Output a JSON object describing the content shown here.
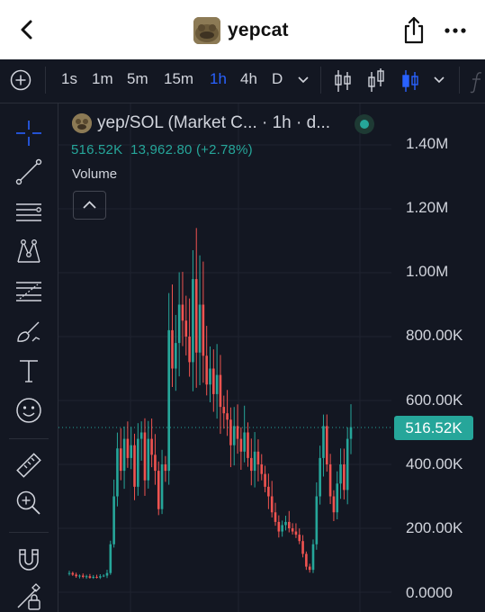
{
  "header": {
    "title": "yepcat",
    "back_icon": "chevron-left-icon",
    "share_icon": "share-icon",
    "more_icon": "more-icon"
  },
  "toolbar": {
    "add_icon": "plus-circle-icon",
    "intervals": [
      "1s",
      "1m",
      "5m",
      "15m",
      "1h",
      "4h",
      "D"
    ],
    "active_interval": "1h",
    "accent_color": "#2962ff"
  },
  "sidebar": {
    "tools": [
      "crosshair-icon",
      "trend-line-icon",
      "horizontal-lines-icon",
      "pattern-icon",
      "fib-icon",
      "brush-icon",
      "text-icon",
      "emoji-icon",
      "ruler-icon",
      "zoom-icon",
      "magnet-icon",
      "lock-icon"
    ]
  },
  "legend": {
    "symbol": "yep/SOL (Market C... · 1h · d...",
    "price": "516.52K",
    "change": "13,962.80 (+2.78%)",
    "volume_label": "Volume"
  },
  "chart_data": {
    "type": "candlestick",
    "up_color": "#26a69a",
    "down_color": "#ef5350",
    "y_tick_labels": [
      "1.40M",
      "1.20M",
      "1.00M",
      "800.00K",
      "600.00K",
      "400.00K",
      "200.00K",
      "0.0000"
    ],
    "last_price_label": "516.52K",
    "last_price": 516520,
    "close_series": [
      60000,
      55000,
      50000,
      52000,
      48000,
      50000,
      45000,
      48000,
      46000,
      50000,
      52000,
      60000,
      150000,
      300000,
      450000,
      380000,
      480000,
      420000,
      460000,
      330000,
      480000,
      500000,
      350000,
      480000,
      430000,
      380000,
      260000,
      400000,
      380000,
      820000,
      700000,
      780000,
      900000,
      850000,
      800000,
      720000,
      980000,
      750000,
      900000,
      740000,
      650000,
      700000,
      620000,
      680000,
      580000,
      560000,
      540000,
      460000,
      520000,
      480000,
      440000,
      500000,
      420000,
      380000,
      440000,
      400000,
      370000,
      330000,
      300000,
      250000,
      220000,
      190000,
      210000,
      220000,
      200000,
      190000,
      180000,
      160000,
      120000,
      80000,
      70000,
      150000,
      300000,
      420000,
      520000,
      400000,
      300000,
      250000,
      340000,
      400000,
      320000,
      480000,
      516520
    ]
  }
}
